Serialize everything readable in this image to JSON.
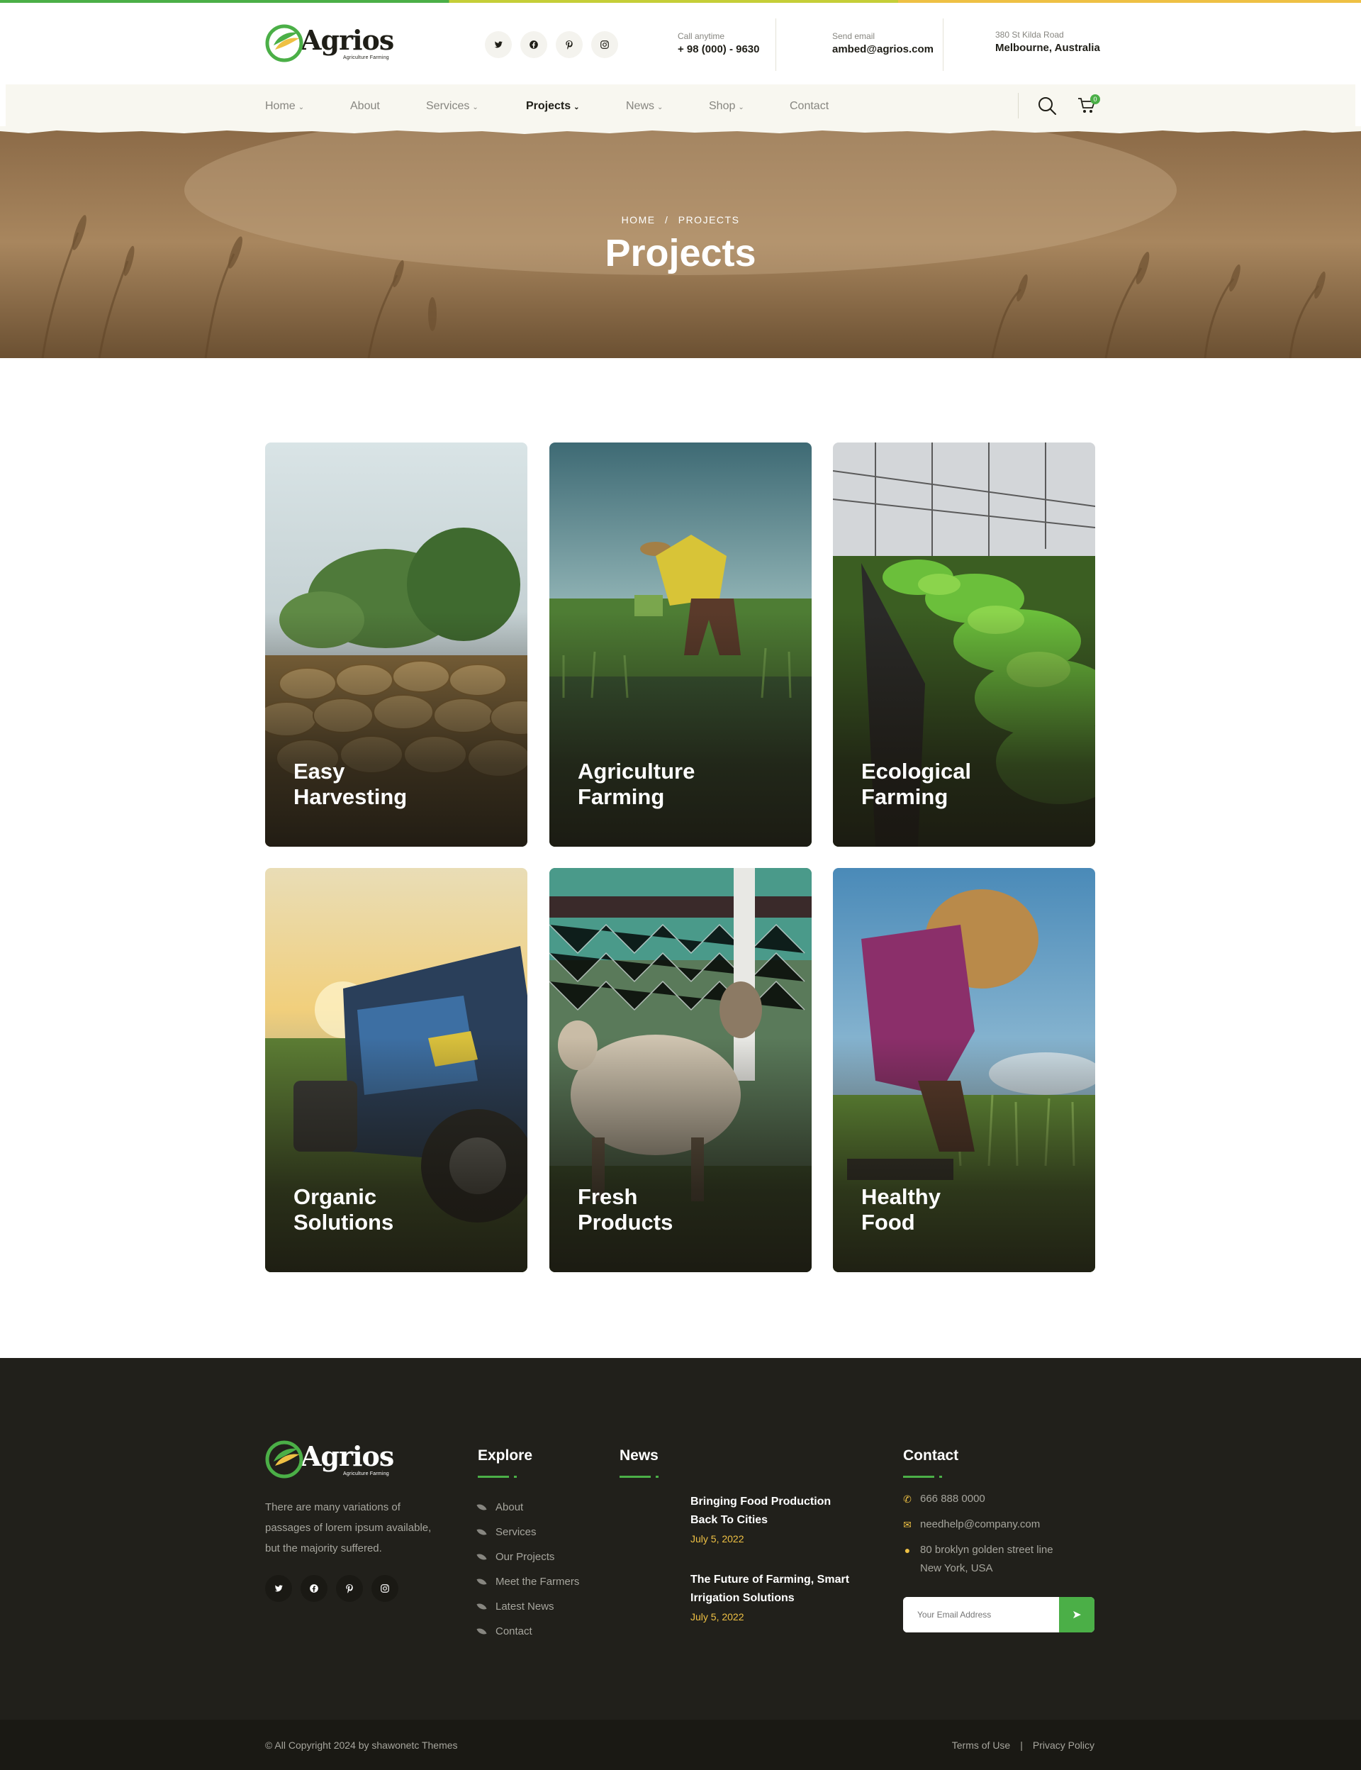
{
  "colors": {
    "brand_green": "#4baf47",
    "accent_yellow": "#eec044",
    "lime": "#c5ce38",
    "dark": "#1f1e17",
    "footer_bg": "#21201b"
  },
  "brand": {
    "name": "Agrios",
    "tagline": "Agriculture Farming"
  },
  "header": {
    "socials": [
      "twitter-icon",
      "facebook-icon",
      "pinterest-icon",
      "instagram-icon"
    ],
    "call": {
      "label": "Call anytime",
      "value": "+ 98 (000) - 9630"
    },
    "email": {
      "label": "Send email",
      "value": "ambed@agrios.com"
    },
    "address": {
      "label": "380 St Kilda Road",
      "value": "Melbourne, Australia"
    }
  },
  "nav": {
    "items": [
      {
        "label": "Home",
        "dropdown": true
      },
      {
        "label": "About",
        "dropdown": false
      },
      {
        "label": "Services",
        "dropdown": true
      },
      {
        "label": "Projects",
        "dropdown": true,
        "active": true
      },
      {
        "label": "News",
        "dropdown": true
      },
      {
        "label": "Shop",
        "dropdown": true
      },
      {
        "label": "Contact",
        "dropdown": false
      }
    ],
    "cart_count": "0"
  },
  "banner": {
    "crumb_home": "HOME",
    "crumb_sep": "/",
    "crumb_current": "PROJECTS",
    "title": "Projects"
  },
  "projects": [
    {
      "line1": "Easy",
      "line2": "Harvesting"
    },
    {
      "line1": "Agriculture",
      "line2": "Farming"
    },
    {
      "line1": "Ecological",
      "line2": "Farming"
    },
    {
      "line1": "Organic",
      "line2": "Solutions"
    },
    {
      "line1": "Fresh",
      "line2": "Products"
    },
    {
      "line1": "Healthy",
      "line2": "Food"
    }
  ],
  "footer": {
    "description": "There are many variations of passages of lorem ipsum available, but the majority suffered.",
    "explore": {
      "heading": "Explore",
      "links": [
        "About",
        "Services",
        "Our Projects",
        "Meet the Farmers",
        "Latest News",
        "Contact"
      ]
    },
    "news": {
      "heading": "News",
      "items": [
        {
          "title": "Bringing Food Production Back To Cities",
          "date": "July 5, 2022"
        },
        {
          "title": "The Future of Farming, Smart Irrigation Solutions",
          "date": "July 5, 2022"
        }
      ]
    },
    "contact": {
      "heading": "Contact",
      "phone": "666 888 0000",
      "email": "needhelp@company.com",
      "address_line1": "80 broklyn golden street line",
      "address_line2": "New York, USA",
      "email_placeholder": "Your Email Address"
    },
    "copyright": "© All Copyright 2024 by shawonetc Themes",
    "terms": "Terms of Use",
    "legal_sep": "|",
    "privacy": "Privacy Policy"
  }
}
